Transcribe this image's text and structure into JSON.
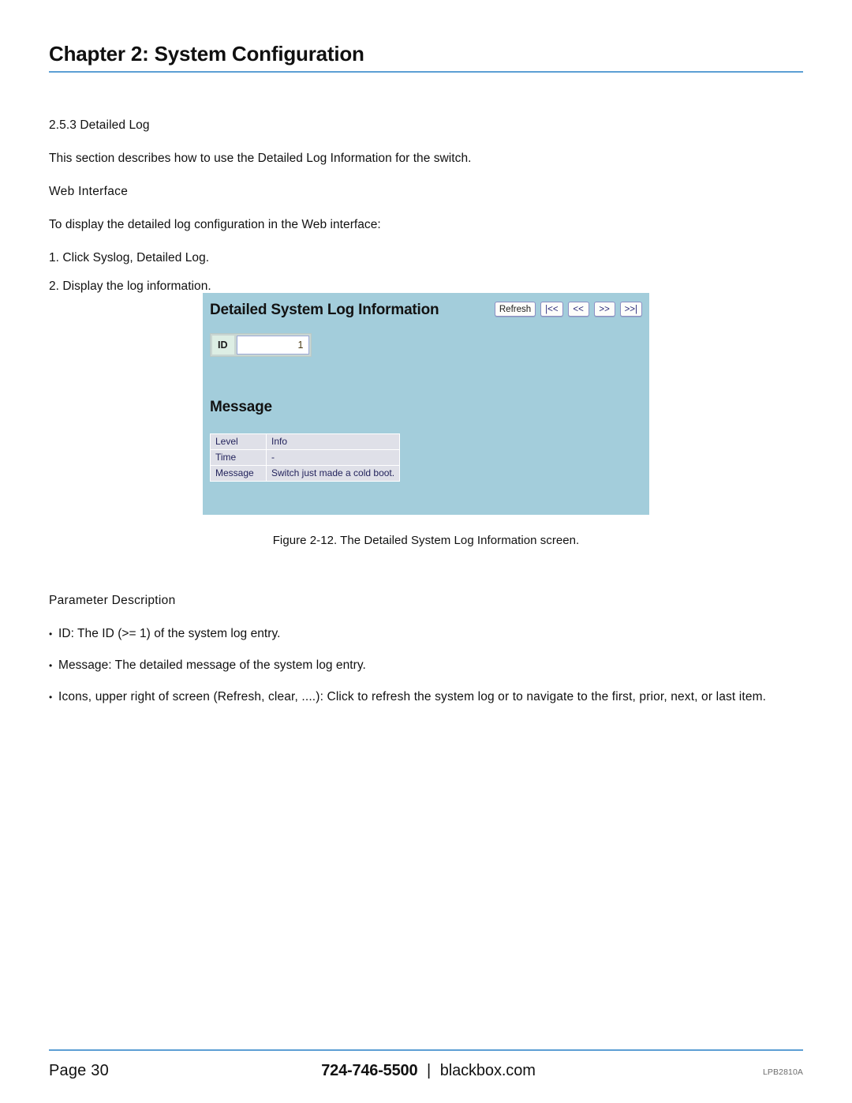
{
  "header": {
    "chapter_title": "Chapter 2: System Configuration"
  },
  "content": {
    "section_heading": "2.5.3 Detailed Log",
    "intro": "This section describes how to use the Detailed Log Information for the switch.",
    "web_interface_heading": "Web Interface",
    "web_interface_intro": "To display the detailed log configuration in the Web interface:",
    "steps": [
      "1. Click Syslog, Detailed Log.",
      "2. Display the log information."
    ]
  },
  "figure": {
    "caption": "Figure 2-12. The Detailed System Log Information screen.",
    "panel": {
      "title": "Detailed System Log Information",
      "buttons": [
        {
          "name": "refresh",
          "label": "Refresh"
        },
        {
          "name": "first",
          "label": "|<<"
        },
        {
          "name": "prior",
          "label": "<<"
        },
        {
          "name": "next",
          "label": ">>"
        },
        {
          "name": "last",
          "label": ">>|"
        }
      ],
      "id_field": {
        "label": "ID",
        "value": "1"
      },
      "message_heading": "Message",
      "table": [
        {
          "key": "Level",
          "value": "Info"
        },
        {
          "key": "Time",
          "value": "-"
        },
        {
          "key": "Message",
          "value": "Switch just made a cold boot."
        }
      ]
    },
    "colors": {
      "panel_background": "#a3cddb",
      "id_label_background": "#ddeee4",
      "table_background": "#dfe0e8",
      "button_text": "#2b2b7a"
    }
  },
  "params": {
    "heading": "Parameter Description",
    "bullets": [
      "ID: The ID (>= 1) of the system log entry.",
      "Message: The detailed message of the system log entry.",
      "Icons, upper right of screen (Refresh, clear, ....): Click to refresh the system log or to navigate to the first, prior, next, or last item."
    ]
  },
  "footer": {
    "page": "Page 30",
    "phone": "724-746-5500",
    "separator": "|",
    "site": "blackbox.com",
    "product_code": "LPB2810A",
    "rule_color": "#5c9fd4"
  }
}
